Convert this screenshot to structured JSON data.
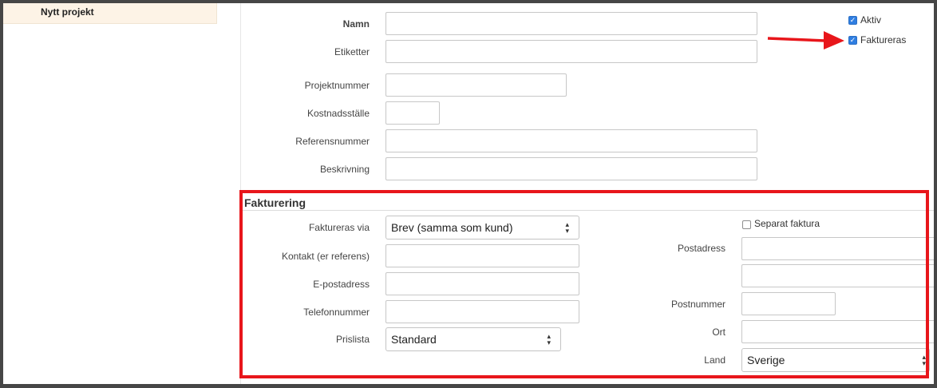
{
  "sidebar": {
    "items": [
      {
        "label": "Nytt projekt"
      }
    ]
  },
  "form": {
    "name_label": "Namn",
    "tags_label": "Etiketter",
    "project_number_label": "Projektnummer",
    "cost_center_label": "Kostnadsställe",
    "reference_number_label": "Referensnummer",
    "description_label": "Beskrivning",
    "active_label": "Aktiv",
    "active_checked": true,
    "invoiced_label": "Faktureras",
    "invoiced_checked": true
  },
  "billing": {
    "section_title": "Fakturering",
    "invoiced_via_label": "Faktureras via",
    "invoiced_via_value": "Brev (samma som kund)",
    "contact_label": "Kontakt (er referens)",
    "email_label": "E-postadress",
    "phone_label": "Telefonnummer",
    "price_list_label": "Prislista",
    "price_list_value": "Standard",
    "separate_invoice_label": "Separat faktura",
    "separate_invoice_checked": false,
    "postal_address_label": "Postadress",
    "postal_code_label": "Postnummer",
    "city_label": "Ort",
    "country_label": "Land",
    "country_value": "Sverige"
  },
  "annotation_colors": {
    "highlight": "#e8161b",
    "arrow": "#e8161b"
  }
}
